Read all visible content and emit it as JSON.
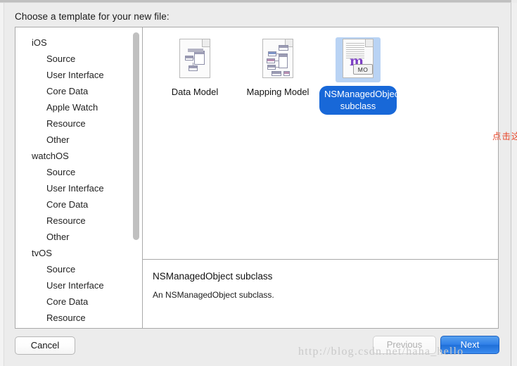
{
  "dialog": {
    "prompt": "Choose a template for your new file:"
  },
  "sidebar": {
    "items": [
      {
        "label": "iOS",
        "type": "group"
      },
      {
        "label": "Source",
        "type": "child"
      },
      {
        "label": "User Interface",
        "type": "child"
      },
      {
        "label": "Core Data",
        "type": "child"
      },
      {
        "label": "Apple Watch",
        "type": "child"
      },
      {
        "label": "Resource",
        "type": "child"
      },
      {
        "label": "Other",
        "type": "child"
      },
      {
        "label": "watchOS",
        "type": "group"
      },
      {
        "label": "Source",
        "type": "child"
      },
      {
        "label": "User Interface",
        "type": "child"
      },
      {
        "label": "Core Data",
        "type": "child"
      },
      {
        "label": "Resource",
        "type": "child"
      },
      {
        "label": "Other",
        "type": "child"
      },
      {
        "label": "tvOS",
        "type": "group"
      },
      {
        "label": "Source",
        "type": "child"
      },
      {
        "label": "User Interface",
        "type": "child"
      },
      {
        "label": "Core Data",
        "type": "child"
      },
      {
        "label": "Resource",
        "type": "child"
      }
    ]
  },
  "templates": [
    {
      "label": "Data Model",
      "icon": "data-model-document-icon",
      "selected": false
    },
    {
      "label": "Mapping Model",
      "icon": "mapping-model-document-icon",
      "selected": false
    },
    {
      "label": "NSManagedObject subclass",
      "icon": "nsmanagedobject-document-icon",
      "selected": true
    }
  ],
  "annotation": {
    "text": "点击这一项",
    "color": "#e8472a"
  },
  "description": {
    "title": "NSManagedObject subclass",
    "body": "An NSManagedObject subclass."
  },
  "buttons": {
    "cancel": "Cancel",
    "previous": "Previous",
    "next": "Next"
  },
  "badges": {
    "mo": "MO"
  },
  "watermark": {
    "text": "http://blog.csdn.net/haha_hello"
  },
  "colors": {
    "selection_blue": "#1868d8",
    "selection_tint": "#b9d3f4",
    "next_button_blue": "#2f7fe8",
    "annotation_red": "#e8472a"
  }
}
